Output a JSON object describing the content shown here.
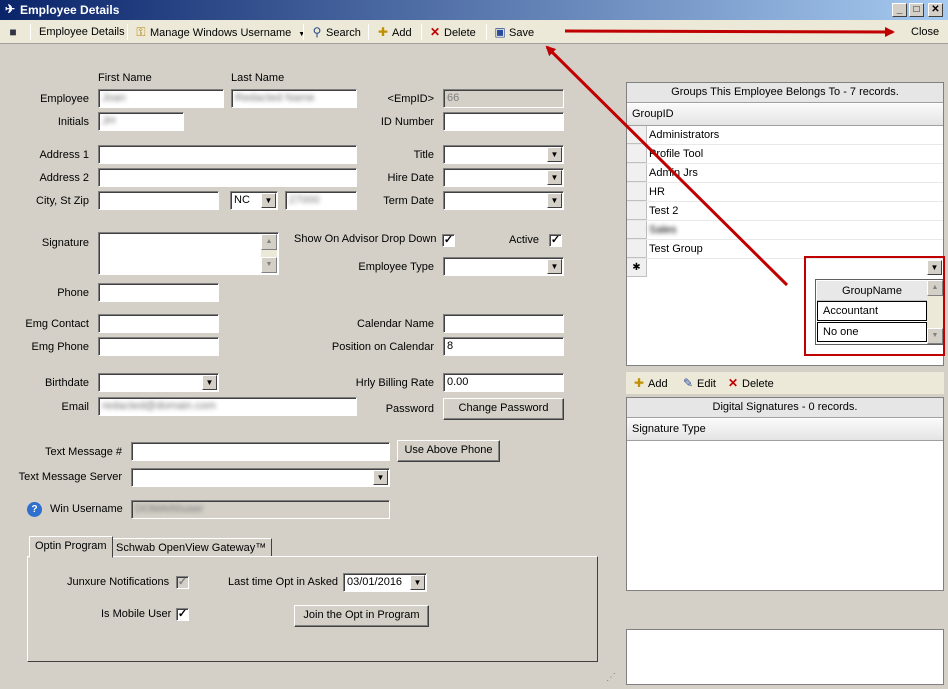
{
  "window": {
    "title": "Employee Details",
    "minimize_glyph": "_",
    "maximize_glyph": "□",
    "close_glyph": "✕"
  },
  "toolbar": {
    "employee_details": "Employee Details",
    "manage_windows_username": "Manage Windows Username",
    "search": "Search",
    "add": "Add",
    "delete": "Delete",
    "save": "Save",
    "close": "Close",
    "dropdown_glyph": "▼"
  },
  "form": {
    "first_name_header": "First Name",
    "last_name_header": "Last Name",
    "employee_label": "Employee",
    "first_name_value": "Joan",
    "last_name_value": "Redacted Name",
    "empid_label": "<EmpID>",
    "empid_value": "66",
    "initials_label": "Initials",
    "initials_value": "JH",
    "id_number_label": "ID Number",
    "id_number_value": "",
    "address1_label": "Address 1",
    "address1_value": "",
    "address2_label": "Address 2",
    "address2_value": "",
    "city_state_zip_label": "City, St Zip",
    "city_value": "",
    "state_value": "NC",
    "zip_value": "27000",
    "title_label": "Title",
    "title_value": "",
    "hire_date_label": "Hire Date",
    "hire_date_value": "",
    "term_date_label": "Term Date",
    "term_date_value": "",
    "signature_label": "Signature",
    "show_on_advisor_label": "Show On Advisor Drop Down",
    "show_on_advisor_checked": "✓",
    "active_label": "Active",
    "active_checked": "✓",
    "employee_type_label": "Employee Type",
    "employee_type_value": "",
    "phone_label": "Phone",
    "phone_value": "",
    "emg_contact_label": "Emg Contact",
    "emg_contact_value": "",
    "emg_phone_label": "Emg Phone",
    "emg_phone_value": "",
    "calendar_name_label": "Calendar Name",
    "calendar_name_value": "",
    "position_on_calendar_label": "Position on Calendar",
    "position_on_calendar_value": "8",
    "birthdate_label": "Birthdate",
    "birthdate_value": "",
    "hrly_billing_rate_label": "Hrly Billing Rate",
    "hrly_billing_rate_value": "0.00",
    "email_label": "Email",
    "email_value": "redacted@domain.com",
    "password_label": "Password",
    "change_password_button": "Change Password",
    "text_message_label": "Text Message #",
    "text_message_value": "",
    "use_above_phone_button": "Use Above Phone",
    "text_message_server_label": "Text Message Server",
    "text_message_server_value": "",
    "help_glyph": "?",
    "win_username_label": "Win Username",
    "win_username_value": "DOMAIN\\user"
  },
  "tabs": {
    "optin_tab": "Optin Program",
    "schwab_tab": "Schwab OpenView Gateway™",
    "junxure_notifications_label": "Junxure Notifications",
    "junxure_notifications_checked": "✓",
    "last_time_opt_in_label": "Last time Opt in Asked",
    "last_time_opt_in_value": "03/01/2016",
    "is_mobile_user_label": "Is Mobile User",
    "is_mobile_user_checked": "✓",
    "join_button": "Join the Opt in Program"
  },
  "groups_panel": {
    "header": "Groups This Employee Belongs To - 7 records.",
    "column": "GroupID",
    "rows": [
      "Administrators",
      "Profile Tool",
      "Admin Jrs",
      "HR",
      "Test 2",
      "Sales",
      "Test Group"
    ],
    "new_row_glyph": "✱",
    "dropdown": {
      "column": "GroupName",
      "options": [
        "Accountant",
        "No one"
      ]
    }
  },
  "groups_actions": {
    "add": "Add",
    "edit": "Edit",
    "delete": "Delete"
  },
  "signatures_panel": {
    "header": "Digital Signatures - 0 records.",
    "column": "Signature Type"
  },
  "colors": {
    "annotation": "#c00000",
    "titlebar_start": "#0a246a",
    "titlebar_end": "#a6caf0"
  }
}
